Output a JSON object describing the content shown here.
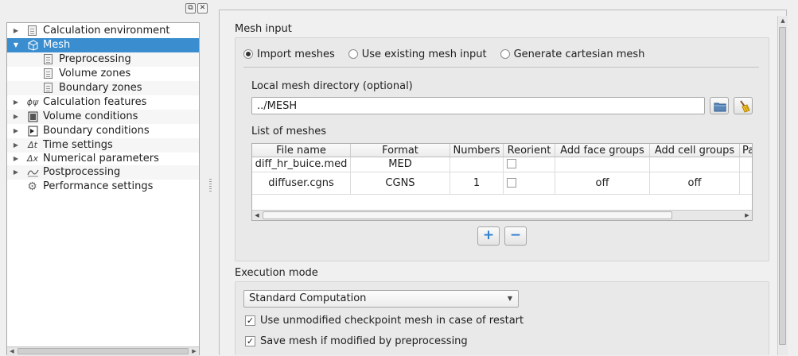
{
  "dock": {
    "float_label": "⧉",
    "close_label": "✕"
  },
  "tree": [
    {
      "label": "Calculation environment",
      "icon": "document-icon",
      "expanded": false,
      "selected": false,
      "level": 0
    },
    {
      "label": "Mesh",
      "icon": "mesh-cube-icon",
      "expanded": true,
      "selected": true,
      "level": 0
    },
    {
      "label": "Preprocessing",
      "icon": "document-icon",
      "level": 1
    },
    {
      "label": "Volume zones",
      "icon": "document-icon",
      "level": 1
    },
    {
      "label": "Boundary zones",
      "icon": "document-icon",
      "level": 1
    },
    {
      "label": "Calculation features",
      "icon": "phi-psi-icon",
      "icon_text": "ϕψ",
      "expanded": false,
      "level": 0
    },
    {
      "label": "Volume conditions",
      "icon": "volume-icon",
      "expanded": false,
      "level": 0
    },
    {
      "label": "Boundary conditions",
      "icon": "boundary-icon",
      "expanded": false,
      "level": 0
    },
    {
      "label": "Time settings",
      "icon": "delta-t-icon",
      "icon_text": "Δt",
      "expanded": false,
      "level": 0
    },
    {
      "label": "Numerical parameters",
      "icon": "delta-x-icon",
      "icon_text": "Δx",
      "expanded": false,
      "level": 0
    },
    {
      "label": "Postprocessing",
      "icon": "curve-icon",
      "expanded": false,
      "level": 0
    },
    {
      "label": "Performance settings",
      "icon": "gear-icon",
      "icon_text": "⚙",
      "level": 0
    }
  ],
  "mesh_input": {
    "title": "Mesh input",
    "radios": [
      {
        "label": "Import meshes",
        "checked": true
      },
      {
        "label": "Use existing mesh input",
        "checked": false
      },
      {
        "label": "Generate cartesian mesh",
        "checked": false
      }
    ],
    "dir_label": "Local mesh directory (optional)",
    "dir_value": "../MESH",
    "list_label": "List of meshes",
    "columns": [
      "File name",
      "Format",
      "Numbers",
      "Reorient",
      "Add face groups",
      "Add cell groups",
      "Pa"
    ],
    "rows": [
      {
        "file": "diff_hr_buice.med",
        "format": "MED",
        "numbers": "",
        "reorient": false,
        "face_groups": "",
        "cell_groups": ""
      },
      {
        "file": "diffuser.cgns",
        "format": "CGNS",
        "numbers": "1",
        "reorient": false,
        "face_groups": "off",
        "cell_groups": "off"
      }
    ],
    "add_label": "+",
    "remove_label": "−"
  },
  "execution": {
    "title": "Execution mode",
    "mode": "Standard Computation",
    "checks": [
      {
        "label": "Use unmodified checkpoint mesh in case of restart",
        "checked": true
      },
      {
        "label": "Save mesh if modified by preprocessing",
        "checked": true
      }
    ]
  },
  "colors": {
    "selection": "#3a8ed0",
    "accent_blue": "#2f7fd0"
  }
}
